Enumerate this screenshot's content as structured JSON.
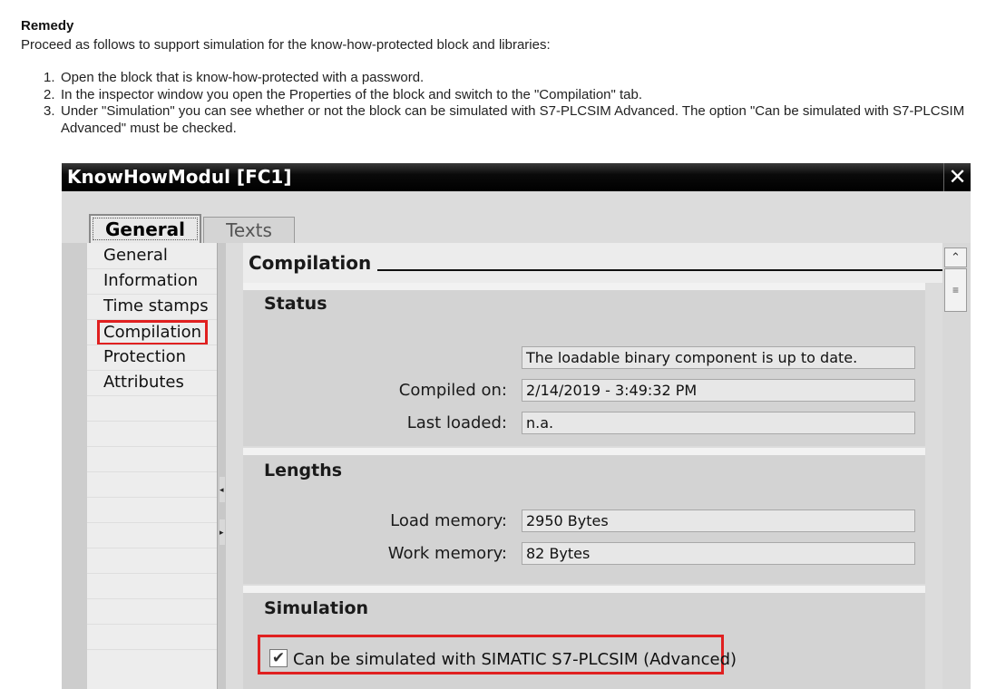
{
  "doc": {
    "heading": "Remedy",
    "intro": "Proceed as follows to support simulation for the know-how-protected block and libraries:",
    "steps": [
      {
        "num": "1.",
        "text": "Open the block that is know-how-protected with a password."
      },
      {
        "num": "2.",
        "text": "In the inspector window you open the Properties of the block and switch to the \"Compilation\" tab."
      },
      {
        "num": "3.",
        "text": "Under \"Simulation\" you can see whether or not the block can be simulated with S7-PLCSIM Advanced. The option \"Can be simulated with S7-PLCSIM Advanced\" must be checked."
      }
    ]
  },
  "dialog": {
    "title": "KnowHowModul [FC1]",
    "close_glyph": "✕",
    "tabs": [
      {
        "label": "General"
      },
      {
        "label": "Texts"
      }
    ],
    "nav": [
      {
        "label": "General"
      },
      {
        "label": "Information"
      },
      {
        "label": "Time stamps"
      },
      {
        "label": "Compilation"
      },
      {
        "label": "Protection"
      },
      {
        "label": "Attributes"
      }
    ],
    "selected_nav": "Compilation",
    "section_title": "Compilation",
    "status": {
      "heading": "Status",
      "state_value": "The loadable binary component is up to date.",
      "compiled_label": "Compiled on:",
      "compiled_value": "2/14/2019 - 3:49:32 PM",
      "loaded_label": "Last loaded:",
      "loaded_value": "n.a."
    },
    "lengths": {
      "heading": "Lengths",
      "load_label": "Load memory:",
      "load_value": "2950 Bytes",
      "work_label": "Work memory:",
      "work_value": "82 Bytes"
    },
    "simulation": {
      "heading": "Simulation",
      "option_label": "Can be simulated with SIMATIC S7-PLCSIM (Advanced)",
      "checked": true,
      "check_glyph": "✔"
    },
    "scroll_up_glyph": "⌃",
    "scroll_thumb_glyph": "≡",
    "splitter_left_glyph": "◂",
    "splitter_right_glyph": "▸",
    "highlight_color": "#e02020"
  }
}
